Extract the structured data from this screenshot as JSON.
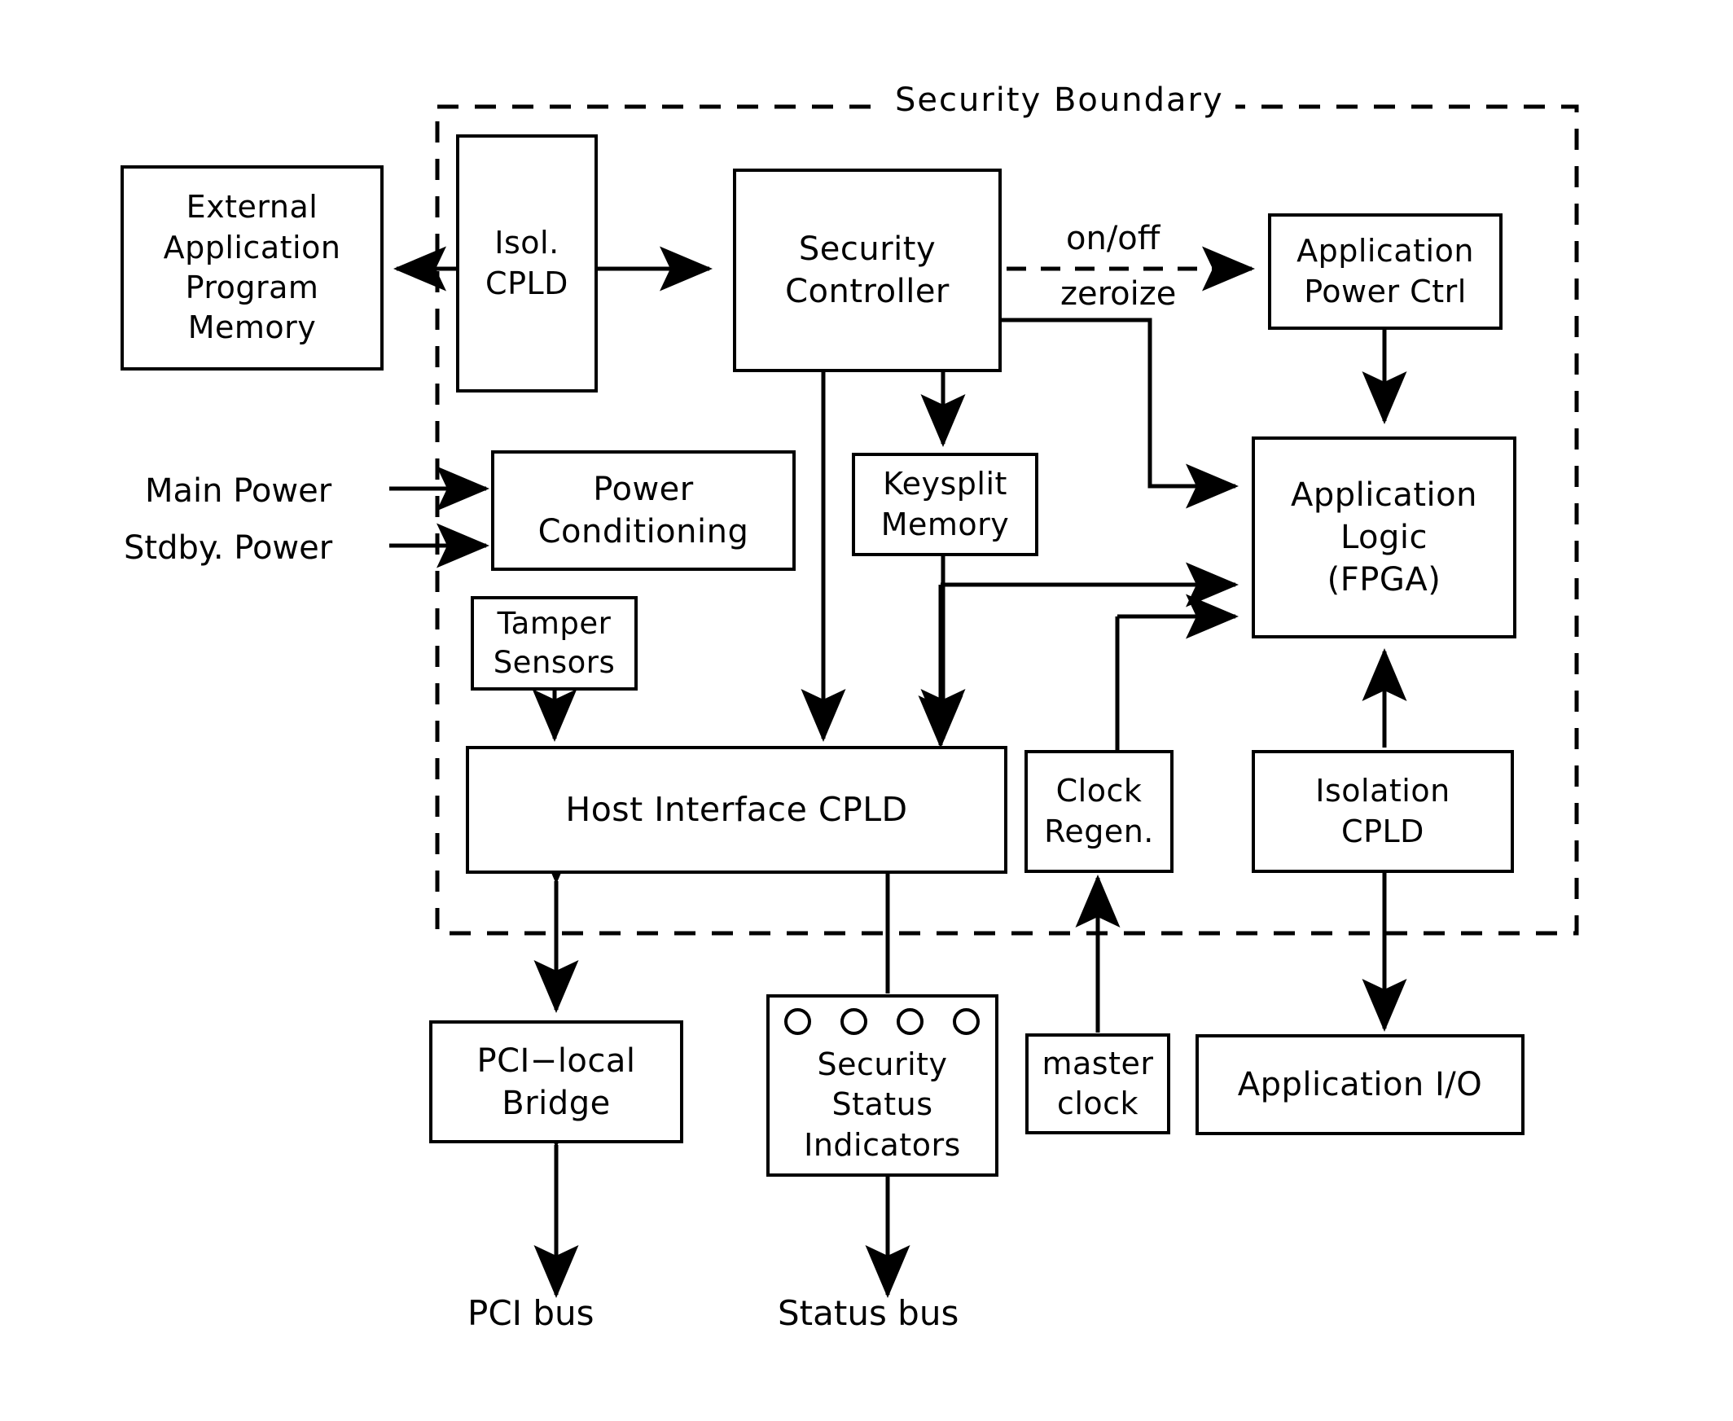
{
  "diagram": {
    "title": "Security Boundary",
    "boundary_label": "Security Boundary",
    "blocks": {
      "external_memory": {
        "line1": "External",
        "line2": "Application",
        "line3": "Program",
        "line4": "Memory"
      },
      "isol_cpld": {
        "line1": "Isol.",
        "line2": "CPLD"
      },
      "security_controller": {
        "line1": "Security",
        "line2": "Controller"
      },
      "application_power_ctrl": {
        "line1": "Application",
        "line2": "Power  Ctrl"
      },
      "power_conditioning": {
        "line1": "Power",
        "line2": "Conditioning"
      },
      "keysplit_memory": {
        "line1": "Keysplit",
        "line2": "Memory"
      },
      "application_logic": {
        "line1": "Application",
        "line2": "Logic",
        "line3": "(FPGA)"
      },
      "tamper_sensors": {
        "line1": "Tamper",
        "line2": "Sensors"
      },
      "host_interface_cpld": {
        "line1": "Host  Interface  CPLD"
      },
      "clock_regen": {
        "line1": "Clock",
        "line2": "Regen."
      },
      "isolation_cpld": {
        "line1": "Isolation",
        "line2": "CPLD"
      },
      "pci_local_bridge": {
        "line1": "PCI−local",
        "line2": "Bridge"
      },
      "security_status_indicators": {
        "line1": "Security",
        "line2": "Status",
        "line3": "Indicators",
        "led_count": 4
      },
      "master_clock": {
        "line1": "master",
        "line2": "clock"
      },
      "application_io": {
        "line1": "Application  I/O"
      }
    },
    "labels": {
      "main_power": "Main  Power",
      "stdby_power": "Stdby.  Power",
      "on_off": "on/off",
      "zeroize": "zeroize",
      "pci_bus": "PCI  bus",
      "status_bus": "Status  bus"
    },
    "colors": {
      "line": "#000000",
      "fill": "#ffffff"
    }
  }
}
